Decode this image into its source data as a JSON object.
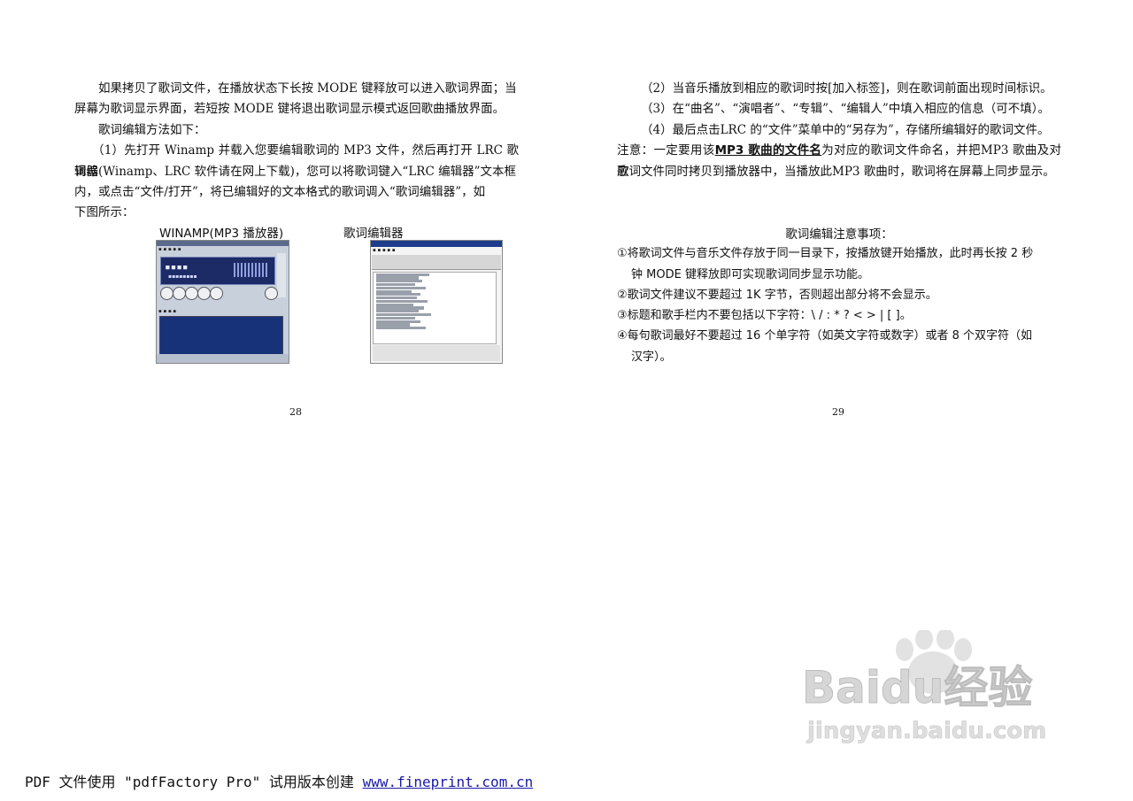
{
  "left_page": {
    "paragraphs": [
      "如果拷贝了歌词文件，在播放状态下长按 MODE 键释放可以进入歌词界面；当",
      "屏幕为歌词显示界面，若短按 MODE 键将退出歌词显示模式返回歌曲播放界面。",
      "歌词编辑方法如下：",
      "（1）先打开 Winamp 并载入您要编辑歌词的 MP3 文件，然后再打开 LRC 歌词编",
      "辑器(Winamp、LRC 软件请在网上下载)，您可以将歌词键入“LRC 编辑器”文本框",
      "内，或点击“文件/打开”，将已编辑好的文本格式的歌词调入“歌词编辑器”，如",
      "下图所示："
    ],
    "figure_caption_left": "WINAMP(MP3 播放器)",
    "figure_caption_right": "歌词编辑器",
    "page_number": "28"
  },
  "right_page": {
    "paragraphs": [
      "（2）当音乐播放到相应的歌词时按[加入标签]，则在歌词前面出现时间标识。",
      "（3）在“曲名”、“演唱者”、“专辑”、“编辑人”中填入相应的信息（可不填）。",
      "（4）最后点击LRC 的“文件”菜单中的“另存为”，存储所编辑好的歌词文件。"
    ],
    "note_prefix": "注意：一定要用该",
    "note_underlined": "MP3 歌曲的文件名",
    "note_suffix": "为对应的歌词文件命名，并把MP3 歌曲及对应",
    "note_line2": "歌词文件同时拷贝到播放器中，当播放此MP3 歌曲时，歌词将在屏幕上同步显示。",
    "section_title": "歌词编辑注意事项：",
    "items": [
      {
        "line1": "①将歌词文件与音乐文件存放于同一目录下，按播放键开始播放，此时再长按 2 秒",
        "line2": "钟 MODE 键释放即可实现歌词同步显示功能。"
      },
      {
        "line1": "②歌词文件建议不要超过 1K 字节，否则超出部分将不会显示。",
        "line2": ""
      },
      {
        "line1": "③标题和歌手栏内不要包括以下字符：\\ / : * ? < > | [ ]。",
        "line2": ""
      },
      {
        "line1": "④每句歌词最好不要超过 16 个单字符（如英文字符或数字）或者 8 个双字符（如",
        "line2": "汉字）。"
      }
    ],
    "page_number": "29"
  },
  "watermark": {
    "brand_line1": "Baidu经验",
    "brand_line2": "jingyan.baidu.com"
  },
  "footer": {
    "text": "PDF 文件使用 \"pdfFactory Pro\" 试用版本创建 ",
    "link": "www.fineprint.com.cn"
  },
  "colors": {
    "text": "#111111",
    "link": "#1a1aa6",
    "watermark": "#d9d9d9"
  }
}
